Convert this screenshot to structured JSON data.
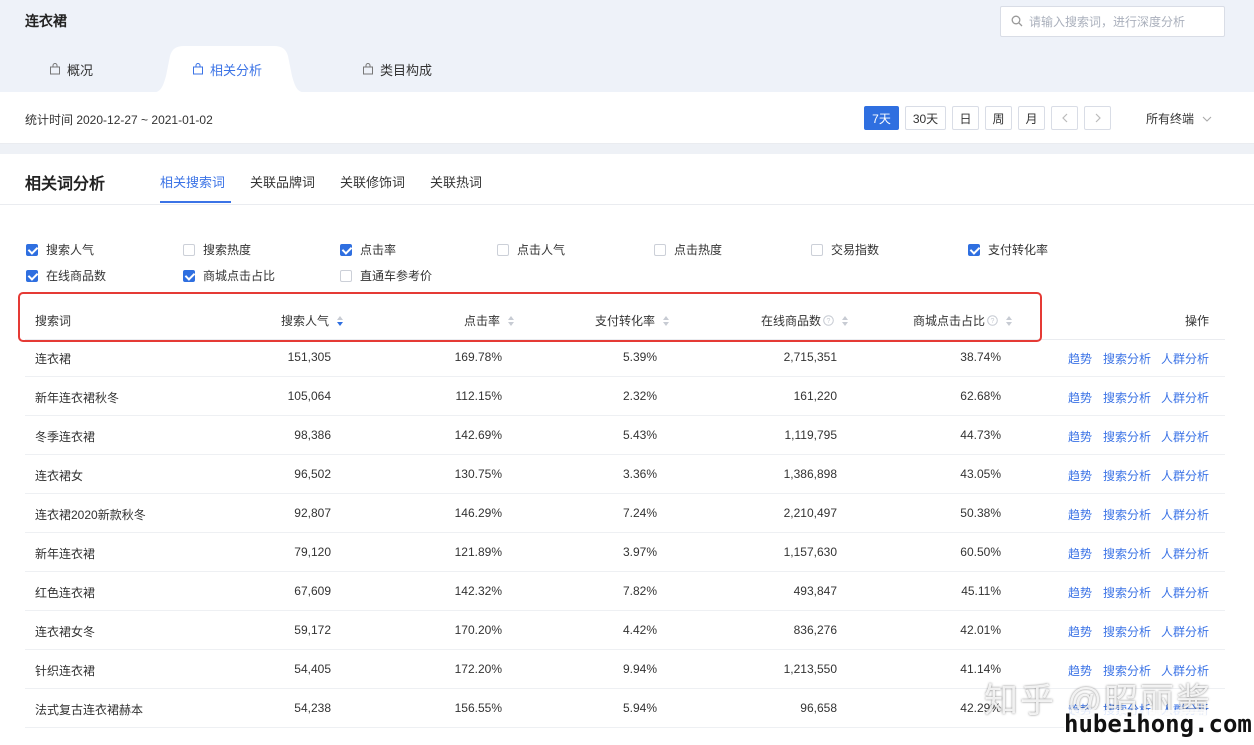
{
  "header": {
    "title": "连衣裙",
    "search_placeholder": "请输入搜索词，进行深度分析"
  },
  "top_tabs": [
    {
      "label": "概况",
      "active": false
    },
    {
      "label": "相关分析",
      "active": true
    },
    {
      "label": "类目构成",
      "active": false
    }
  ],
  "date_bar": {
    "stat_time": "统计时间 2020-12-27 ~ 2021-01-02",
    "ranges": [
      {
        "label": "7天",
        "active": true
      },
      {
        "label": "30天",
        "active": false
      },
      {
        "label": "日",
        "active": false
      },
      {
        "label": "周",
        "active": false
      },
      {
        "label": "月",
        "active": false
      }
    ],
    "terminal_label": "所有终端"
  },
  "section": {
    "title": "相关词分析",
    "sub_tabs": [
      "相关搜索词",
      "关联品牌词",
      "关联修饰词",
      "关联热词"
    ]
  },
  "metrics": [
    {
      "label": "搜索人气",
      "checked": true
    },
    {
      "label": "搜索热度",
      "checked": false
    },
    {
      "label": "点击率",
      "checked": true
    },
    {
      "label": "点击人气",
      "checked": false
    },
    {
      "label": "点击热度",
      "checked": false
    },
    {
      "label": "交易指数",
      "checked": false
    },
    {
      "label": "支付转化率",
      "checked": true
    },
    {
      "label": "在线商品数",
      "checked": true
    },
    {
      "label": "商城点击占比",
      "checked": true
    },
    {
      "label": "直通车参考价",
      "checked": false
    }
  ],
  "table": {
    "headers": [
      "搜索词",
      "搜索人气",
      "点击率",
      "支付转化率",
      "在线商品数",
      "商城点击占比",
      "操作"
    ],
    "actions": [
      "趋势",
      "搜索分析",
      "人群分析"
    ],
    "rows": [
      [
        "连衣裙",
        "151,305",
        "169.78%",
        "5.39%",
        "2,715,351",
        "38.74%"
      ],
      [
        "新年连衣裙秋冬",
        "105,064",
        "112.15%",
        "2.32%",
        "161,220",
        "62.68%"
      ],
      [
        "冬季连衣裙",
        "98,386",
        "142.69%",
        "5.43%",
        "1,119,795",
        "44.73%"
      ],
      [
        "连衣裙女",
        "96,502",
        "130.75%",
        "3.36%",
        "1,386,898",
        "43.05%"
      ],
      [
        "连衣裙2020新款秋冬",
        "92,807",
        "146.29%",
        "7.24%",
        "2,210,497",
        "50.38%"
      ],
      [
        "新年连衣裙",
        "79,120",
        "121.89%",
        "3.97%",
        "1,157,630",
        "60.50%"
      ],
      [
        "红色连衣裙",
        "67,609",
        "142.32%",
        "7.82%",
        "493,847",
        "45.11%"
      ],
      [
        "连衣裙女冬",
        "59,172",
        "170.20%",
        "4.42%",
        "836,276",
        "42.01%"
      ],
      [
        "针织连衣裙",
        "54,405",
        "172.20%",
        "9.94%",
        "1,213,550",
        "41.14%"
      ],
      [
        "法式复古连衣裙赫本",
        "54,238",
        "156.55%",
        "5.94%",
        "96,658",
        "42.29%"
      ]
    ]
  },
  "watermark": {
    "text": "知乎 @昭丽酱",
    "url": "hubeihong.com"
  },
  "colors": {
    "accent": "#2f6fe0",
    "link": "#3b73e6",
    "highlight": "#e53a35",
    "header_bg": "#eef2f9"
  }
}
